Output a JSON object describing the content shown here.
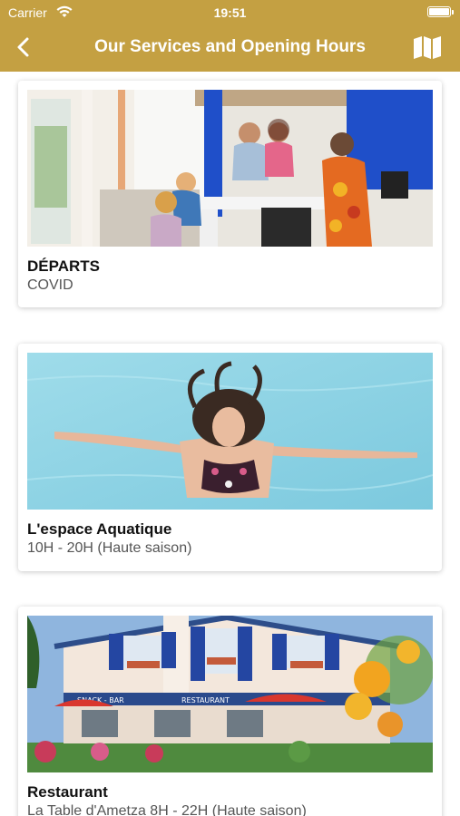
{
  "status_bar": {
    "carrier": "Carrier",
    "time": "19:51"
  },
  "nav": {
    "title": "Our Services and Opening Hours",
    "back_icon": "chevron-left-icon",
    "map_icon": "map-icon"
  },
  "colors": {
    "header": "#c4a042",
    "pool": "#8fd3e6"
  },
  "cards": [
    {
      "name": "DÉPARTS",
      "sub": "COVID"
    },
    {
      "name": "L'espace Aquatique",
      "sub": "10H - 20H (Haute saison)"
    },
    {
      "name": "Restaurant",
      "sub": "La Table d'Ametza 8H - 22H (Haute saison)",
      "sign_snack": "SNACK - BAR",
      "sign_restaurant": "RESTAURANT"
    }
  ]
}
